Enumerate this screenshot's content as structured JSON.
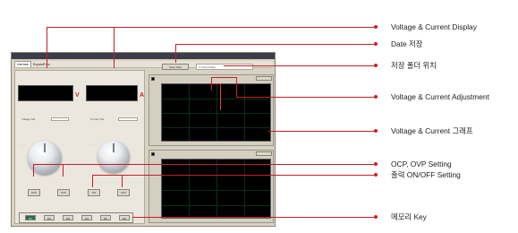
{
  "window": {
    "tabs": [
      {
        "label": "Interface"
      },
      {
        "label": "ExpandFunc"
      }
    ],
    "voltage_unit": "V",
    "current_unit": "A",
    "set_buttons": [
      "OCP",
      "OVP",
      "ON",
      "OFF"
    ],
    "memory_keys": [
      "M1",
      "M2",
      "M3",
      "M4",
      "M5",
      "M6"
    ],
    "date_save_button": "Save Date",
    "folder_path": "C:\\Users\\Data"
  },
  "callouts": [
    {
      "label": "Voltage & Current Display"
    },
    {
      "label": "Date 저장"
    },
    {
      "label": "저장 폴더 위치"
    },
    {
      "label": "Voltage & Current Adjustment"
    },
    {
      "label": "Voltage & Current 그래프"
    },
    {
      "label": "OCP, OVP Setting"
    },
    {
      "label": "출력 ON/OFF Setting"
    },
    {
      "label": "메모리 Key"
    }
  ],
  "colors": {
    "callout_line": "#c41f2a",
    "unit_red": "#c8282c",
    "memory_active": "#2c6b4f",
    "graph_bg": "#000000"
  }
}
